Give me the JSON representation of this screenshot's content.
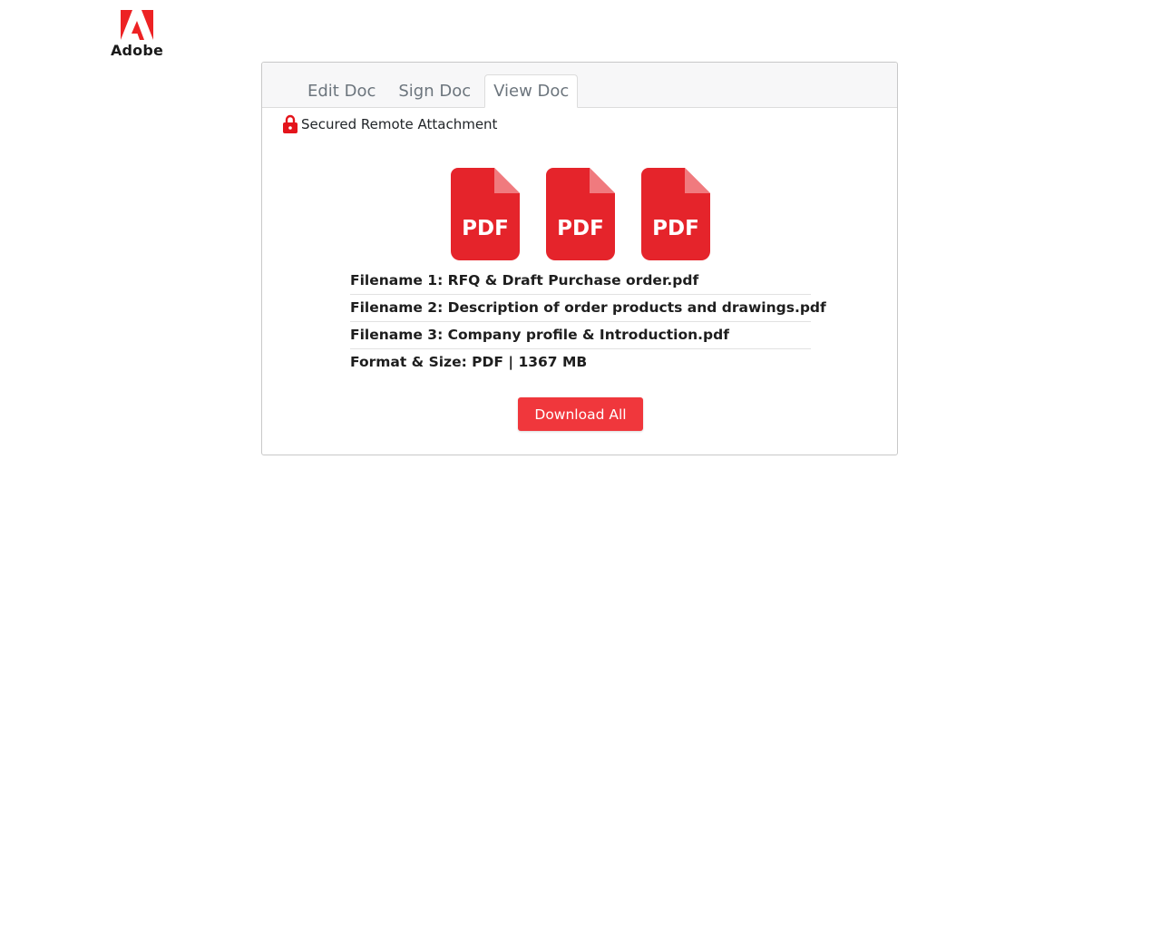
{
  "brand": {
    "name": "Adobe",
    "color": "#ed2224"
  },
  "tabs": [
    {
      "label": "Edit Doc",
      "active": false
    },
    {
      "label": "Sign Doc",
      "active": false
    },
    {
      "label": "View Doc",
      "active": true
    }
  ],
  "secured": {
    "label": "Secured Remote Attachment",
    "icon": "lock-icon"
  },
  "pdf_icons": [
    {
      "label": "PDF",
      "icon": "pdf-file-icon"
    },
    {
      "label": "PDF",
      "icon": "pdf-file-icon"
    },
    {
      "label": "PDF",
      "icon": "pdf-file-icon"
    }
  ],
  "files": [
    "Filename 1: RFQ & Draft Purchase order.pdf",
    "Filename 2: Description of order products and drawings.pdf",
    "Filename 3: Company profile & Introduction.pdf"
  ],
  "format_size": "Format & Size: PDF | 1367 MB",
  "download_label": "Download All",
  "colors": {
    "pdf_red": "#e5242b",
    "button_red": "#f0373c"
  }
}
